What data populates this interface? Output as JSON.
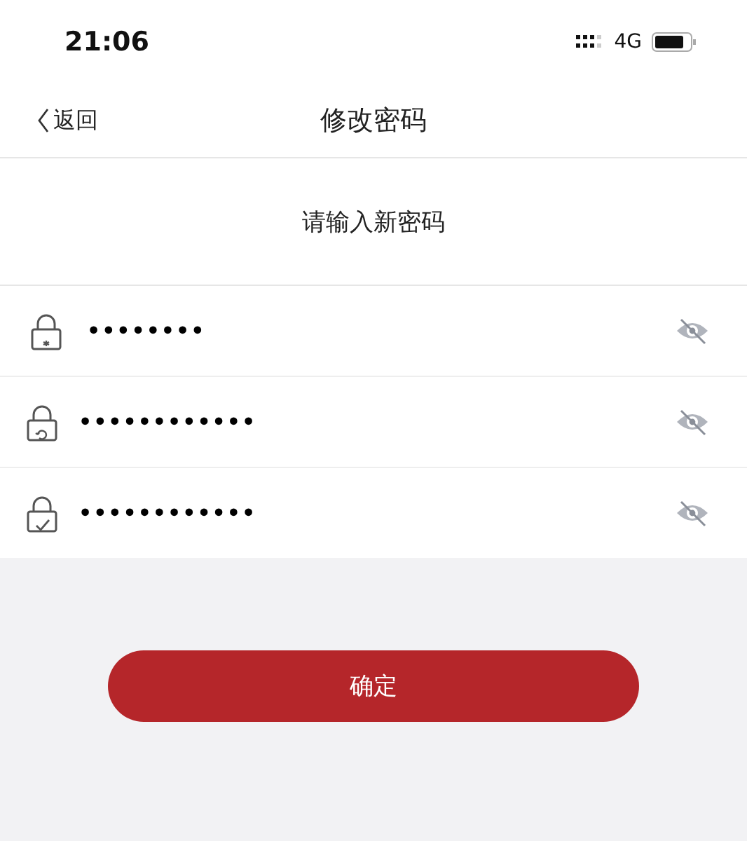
{
  "status_bar": {
    "time": "21:06",
    "network": "4G"
  },
  "nav": {
    "back": "返回",
    "title": "修改密码"
  },
  "prompt": "请输入新密码",
  "fields": [
    {
      "kind": "current",
      "value": "••••••••",
      "revealed": false
    },
    {
      "kind": "new",
      "value": "••••••••••••",
      "revealed": false
    },
    {
      "kind": "confirm",
      "value": "••••••••••••",
      "revealed": false
    }
  ],
  "submit": "确定"
}
